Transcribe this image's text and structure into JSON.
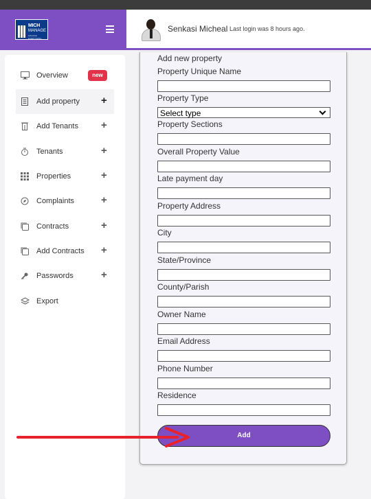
{
  "brand": {
    "logo_text_1": "MICH",
    "logo_text_2": "MANAGE",
    "logo_text_3": "MANAGE EVERYTHING"
  },
  "header": {
    "username": "Senkasi Micheal",
    "last_login": "Last login was 8 hours ago."
  },
  "sidebar": {
    "items": [
      {
        "label": "Overview",
        "icon": "monitor-icon",
        "badge": "new"
      },
      {
        "label": "Add property",
        "icon": "document-icon",
        "plus": "+"
      },
      {
        "label": "Add Tenants",
        "icon": "building-icon",
        "plus": "+"
      },
      {
        "label": "Tenants",
        "icon": "stopwatch-icon",
        "plus": "+"
      },
      {
        "label": "Properties",
        "icon": "grid-icon",
        "plus": "+"
      },
      {
        "label": "Complaints",
        "icon": "compass-icon",
        "plus": "+"
      },
      {
        "label": "Contracts",
        "icon": "copy-icon",
        "plus": "+"
      },
      {
        "label": "Add Contracts",
        "icon": "copy-icon",
        "plus": "+"
      },
      {
        "label": "Passwords",
        "icon": "key-icon",
        "plus": "+"
      },
      {
        "label": "Export",
        "icon": "layers-icon"
      }
    ]
  },
  "form": {
    "title": "Add new property",
    "fields": [
      {
        "label": "Property Unique Name",
        "value": ""
      },
      {
        "label": "Property Type",
        "value": "Select type"
      },
      {
        "label": "Property Sections",
        "value": ""
      },
      {
        "label": "Overall Property Value",
        "value": ""
      },
      {
        "label": "Late payment day",
        "value": ""
      },
      {
        "label": "Property Address",
        "value": ""
      },
      {
        "label": "City",
        "value": ""
      },
      {
        "label": "State/Province",
        "value": ""
      },
      {
        "label": "County/Parish",
        "value": ""
      },
      {
        "label": "Owner Name",
        "value": ""
      },
      {
        "label": "Email Address",
        "value": ""
      },
      {
        "label": "Phone Number",
        "value": ""
      },
      {
        "label": "Residence",
        "value": ""
      }
    ],
    "submit_label": "Add"
  },
  "colors": {
    "brand_purple": "#7e4fc2",
    "badge_red": "#e0334a",
    "arrow_red": "#e8222d"
  }
}
